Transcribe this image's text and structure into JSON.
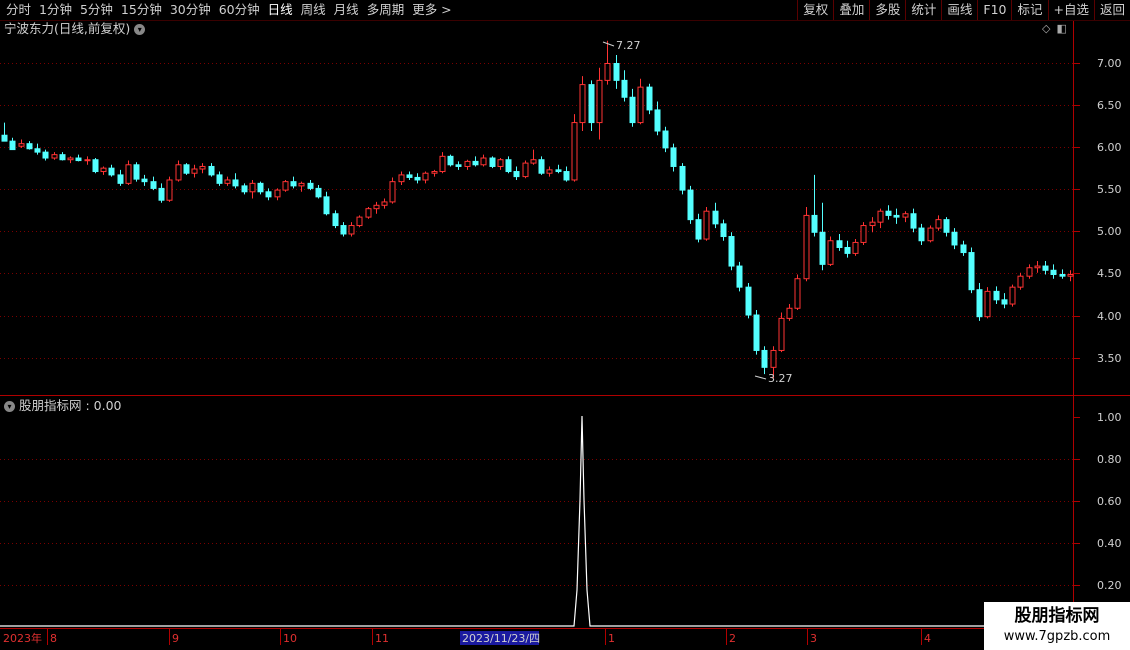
{
  "toolbar": {
    "periods": [
      "分时",
      "1分钟",
      "5分钟",
      "15分钟",
      "30分钟",
      "60分钟",
      "日线",
      "周线",
      "月线",
      "多周期",
      "更多 >"
    ],
    "active_period": "日线",
    "actions": [
      "复权",
      "叠加",
      "多股",
      "统计",
      "画线",
      "F10",
      "标记",
      "+自选",
      "返回"
    ]
  },
  "main_chart": {
    "title": "宁波东力(日线,前复权)",
    "y_ticks": [
      "7.00",
      "6.50",
      "6.00",
      "5.50",
      "5.00",
      "4.50",
      "4.00",
      "3.50"
    ],
    "high_label": "7.27",
    "low_label": "3.27"
  },
  "indicator": {
    "title": "股朋指标网 : 0.00",
    "y_ticks": [
      "1.00",
      "0.80",
      "0.60",
      "0.40",
      "0.20"
    ]
  },
  "x_axis": {
    "labels": [
      "2023年",
      "8",
      "9",
      "10",
      "11",
      "1",
      "2",
      "3",
      "4"
    ],
    "cursor_date": "2023/11/23/四"
  },
  "watermark": {
    "line1": "股朋指标网",
    "line2": "www.7gpzb.com"
  },
  "colors": {
    "up": "#ff3333",
    "down": "#54ffff",
    "grid": "#7a0000",
    "indicator_line": "#ffffff"
  },
  "candles": [
    [
      6.15,
      6.3,
      6.12,
      6.08
    ],
    [
      6.08,
      6.12,
      6.0,
      5.98
    ],
    [
      6.02,
      6.1,
      6.0,
      6.05
    ],
    [
      6.05,
      6.08,
      5.98,
      5.99
    ],
    [
      5.99,
      6.05,
      5.92,
      5.95
    ],
    [
      5.95,
      5.98,
      5.85,
      5.88
    ],
    [
      5.88,
      5.95,
      5.86,
      5.92
    ],
    [
      5.92,
      5.95,
      5.85,
      5.86
    ],
    [
      5.86,
      5.9,
      5.82,
      5.88
    ],
    [
      5.88,
      5.92,
      5.84,
      5.85
    ],
    [
      5.85,
      5.9,
      5.8,
      5.86
    ],
    [
      5.86,
      5.88,
      5.7,
      5.72
    ],
    [
      5.72,
      5.78,
      5.68,
      5.76
    ],
    [
      5.76,
      5.8,
      5.66,
      5.68
    ],
    [
      5.68,
      5.74,
      5.55,
      5.58
    ],
    [
      5.58,
      5.85,
      5.56,
      5.8
    ],
    [
      5.8,
      5.83,
      5.6,
      5.63
    ],
    [
      5.63,
      5.68,
      5.55,
      5.6
    ],
    [
      5.6,
      5.66,
      5.5,
      5.52
    ],
    [
      5.52,
      5.58,
      5.35,
      5.38
    ],
    [
      5.38,
      5.66,
      5.36,
      5.62
    ],
    [
      5.62,
      5.85,
      5.6,
      5.8
    ],
    [
      5.8,
      5.82,
      5.68,
      5.7
    ],
    [
      5.7,
      5.8,
      5.65,
      5.75
    ],
    [
      5.75,
      5.82,
      5.7,
      5.78
    ],
    [
      5.78,
      5.82,
      5.66,
      5.68
    ],
    [
      5.68,
      5.72,
      5.55,
      5.58
    ],
    [
      5.58,
      5.66,
      5.55,
      5.62
    ],
    [
      5.62,
      5.7,
      5.52,
      5.55
    ],
    [
      5.55,
      5.58,
      5.45,
      5.48
    ],
    [
      5.48,
      5.62,
      5.4,
      5.58
    ],
    [
      5.58,
      5.6,
      5.45,
      5.48
    ],
    [
      5.48,
      5.52,
      5.38,
      5.42
    ],
    [
      5.42,
      5.52,
      5.38,
      5.5
    ],
    [
      5.5,
      5.62,
      5.48,
      5.6
    ],
    [
      5.6,
      5.66,
      5.52,
      5.55
    ],
    [
      5.55,
      5.6,
      5.48,
      5.58
    ],
    [
      5.58,
      5.62,
      5.5,
      5.52
    ],
    [
      5.52,
      5.56,
      5.4,
      5.42
    ],
    [
      5.42,
      5.48,
      5.2,
      5.22
    ],
    [
      5.22,
      5.26,
      5.05,
      5.08
    ],
    [
      5.08,
      5.12,
      4.95,
      4.98
    ],
    [
      4.98,
      5.12,
      4.95,
      5.08
    ],
    [
      5.08,
      5.2,
      5.06,
      5.18
    ],
    [
      5.18,
      5.3,
      5.16,
      5.28
    ],
    [
      5.28,
      5.36,
      5.22,
      5.32
    ],
    [
      5.32,
      5.4,
      5.28,
      5.36
    ],
    [
      5.36,
      5.65,
      5.34,
      5.6
    ],
    [
      5.6,
      5.72,
      5.56,
      5.68
    ],
    [
      5.68,
      5.72,
      5.62,
      5.65
    ],
    [
      5.65,
      5.7,
      5.58,
      5.62
    ],
    [
      5.62,
      5.72,
      5.58,
      5.7
    ],
    [
      5.7,
      5.74,
      5.66,
      5.72
    ],
    [
      5.72,
      5.95,
      5.7,
      5.9
    ],
    [
      5.9,
      5.92,
      5.78,
      5.8
    ],
    [
      5.8,
      5.84,
      5.74,
      5.78
    ],
    [
      5.78,
      5.86,
      5.74,
      5.84
    ],
    [
      5.84,
      5.9,
      5.78,
      5.8
    ],
    [
      5.8,
      5.92,
      5.78,
      5.88
    ],
    [
      5.88,
      5.9,
      5.76,
      5.78
    ],
    [
      5.78,
      5.88,
      5.74,
      5.86
    ],
    [
      5.86,
      5.9,
      5.7,
      5.72
    ],
    [
      5.72,
      5.78,
      5.62,
      5.66
    ],
    [
      5.66,
      5.85,
      5.64,
      5.82
    ],
    [
      5.82,
      5.98,
      5.8,
      5.86
    ],
    [
      5.86,
      5.9,
      5.68,
      5.7
    ],
    [
      5.7,
      5.78,
      5.66,
      5.74
    ],
    [
      5.74,
      5.8,
      5.7,
      5.72
    ],
    [
      5.72,
      5.78,
      5.6,
      5.62
    ],
    [
      5.62,
      6.4,
      5.6,
      6.3
    ],
    [
      6.3,
      6.85,
      6.2,
      6.75
    ],
    [
      6.75,
      6.8,
      6.2,
      6.3
    ],
    [
      6.3,
      6.95,
      6.1,
      6.8
    ],
    [
      6.8,
      7.27,
      6.75,
      7.0
    ],
    [
      7.0,
      7.1,
      6.7,
      6.8
    ],
    [
      6.8,
      6.92,
      6.55,
      6.6
    ],
    [
      6.6,
      6.7,
      6.25,
      6.3
    ],
    [
      6.3,
      6.82,
      6.28,
      6.72
    ],
    [
      6.72,
      6.76,
      6.4,
      6.45
    ],
    [
      6.45,
      6.55,
      6.15,
      6.2
    ],
    [
      6.2,
      6.25,
      5.95,
      6.0
    ],
    [
      6.0,
      6.05,
      5.72,
      5.78
    ],
    [
      5.78,
      5.82,
      5.45,
      5.5
    ],
    [
      5.5,
      5.55,
      5.1,
      5.15
    ],
    [
      5.15,
      5.22,
      4.88,
      4.92
    ],
    [
      4.92,
      5.3,
      4.9,
      5.25
    ],
    [
      5.25,
      5.35,
      5.05,
      5.1
    ],
    [
      5.1,
      5.15,
      4.9,
      4.95
    ],
    [
      4.95,
      5.0,
      4.55,
      4.6
    ],
    [
      4.6,
      4.65,
      4.3,
      4.35
    ],
    [
      4.35,
      4.4,
      3.98,
      4.02
    ],
    [
      4.02,
      4.08,
      3.55,
      3.6
    ],
    [
      3.6,
      3.65,
      3.32,
      3.4
    ],
    [
      3.4,
      3.65,
      3.27,
      3.6
    ],
    [
      3.6,
      4.05,
      3.58,
      3.98
    ],
    [
      3.98,
      4.15,
      3.95,
      4.1
    ],
    [
      4.1,
      4.5,
      4.08,
      4.45
    ],
    [
      4.45,
      5.3,
      4.42,
      5.2
    ],
    [
      5.2,
      5.68,
      4.95,
      5.0
    ],
    [
      5.0,
      5.35,
      4.55,
      4.62
    ],
    [
      4.62,
      4.95,
      4.6,
      4.9
    ],
    [
      4.9,
      4.98,
      4.78,
      4.82
    ],
    [
      4.82,
      4.9,
      4.7,
      4.75
    ],
    [
      4.75,
      4.92,
      4.72,
      4.88
    ],
    [
      4.88,
      5.12,
      4.85,
      5.08
    ],
    [
      5.08,
      5.18,
      5.0,
      5.12
    ],
    [
      5.12,
      5.28,
      5.05,
      5.25
    ],
    [
      5.25,
      5.32,
      5.15,
      5.2
    ],
    [
      5.2,
      5.28,
      5.1,
      5.18
    ],
    [
      5.18,
      5.25,
      5.12,
      5.22
    ],
    [
      5.22,
      5.28,
      5.0,
      5.05
    ],
    [
      5.05,
      5.1,
      4.85,
      4.9
    ],
    [
      4.9,
      5.08,
      4.88,
      5.05
    ],
    [
      5.05,
      5.2,
      5.02,
      5.15
    ],
    [
      5.15,
      5.18,
      4.95,
      5.0
    ],
    [
      5.0,
      5.05,
      4.8,
      4.85
    ],
    [
      4.85,
      4.9,
      4.72,
      4.76
    ],
    [
      4.76,
      4.82,
      4.28,
      4.32
    ],
    [
      4.32,
      4.4,
      3.95,
      4.0
    ],
    [
      4.0,
      4.35,
      3.98,
      4.3
    ],
    [
      4.3,
      4.36,
      4.15,
      4.2
    ],
    [
      4.2,
      4.28,
      4.1,
      4.15
    ],
    [
      4.15,
      4.38,
      4.12,
      4.35
    ],
    [
      4.35,
      4.52,
      4.32,
      4.48
    ],
    [
      4.48,
      4.62,
      4.45,
      4.58
    ],
    [
      4.58,
      4.66,
      4.52,
      4.6
    ],
    [
      4.6,
      4.66,
      4.5,
      4.55
    ],
    [
      4.55,
      4.62,
      4.45,
      4.5
    ],
    [
      4.5,
      4.56,
      4.45,
      4.48
    ],
    [
      4.48,
      4.55,
      4.42,
      4.5
    ]
  ]
}
